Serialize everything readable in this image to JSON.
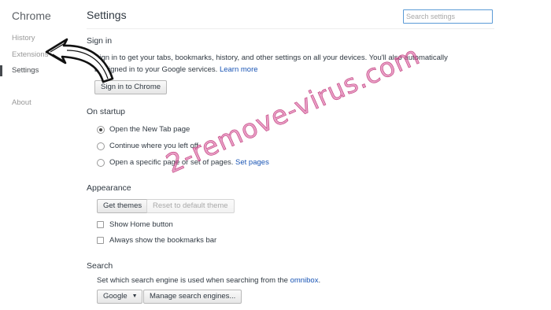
{
  "sidebar": {
    "brand": "Chrome",
    "items": [
      {
        "label": "History",
        "selected": false
      },
      {
        "label": "Extensions",
        "selected": false
      },
      {
        "label": "Settings",
        "selected": true
      },
      {
        "label": "About",
        "selected": false
      }
    ]
  },
  "header": {
    "title": "Settings",
    "search_placeholder": "Search settings"
  },
  "signin": {
    "title": "Sign in",
    "line1": "Sign in to get your tabs, bookmarks, history, and other settings on all your devices. You'll also automatically",
    "line2": "be signed in to your Google services.",
    "learn_more": "Learn more",
    "button": "Sign in to Chrome"
  },
  "startup": {
    "title": "On startup",
    "options": [
      {
        "label": "Open the New Tab page",
        "checked": true
      },
      {
        "label": "Continue where you left off",
        "checked": false
      },
      {
        "label": "Open a specific page or set of pages.",
        "checked": false
      }
    ],
    "set_pages_link": "Set pages"
  },
  "appearance": {
    "title": "Appearance",
    "get_themes": "Get themes",
    "reset_theme": "Reset to default theme",
    "show_home_button": "Show Home button",
    "show_bookmarks_bar": "Always show the bookmarks bar"
  },
  "search": {
    "title": "Search",
    "description": "Set which search engine is used when searching from the",
    "omnibox_link": "omnibox",
    "description_end": ".",
    "engine": "Google",
    "manage_button": "Manage search engines..."
  },
  "overlay": {
    "watermark": "2-remove-virus.com",
    "watermark_color": "#d64d96",
    "arrow_icon": "hand-drawn-arrow-icon"
  }
}
